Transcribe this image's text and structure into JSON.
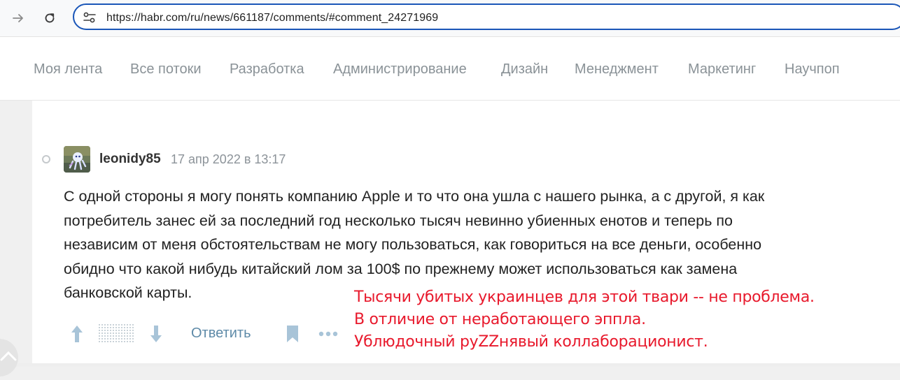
{
  "browser": {
    "url": "https://habr.com/ru/news/661187/comments/#comment_24271969"
  },
  "nav": {
    "items": [
      "Моя лента",
      "Все потоки",
      "Разработка",
      "Администрирование",
      "Дизайн",
      "Менеджмент",
      "Маркетинг",
      "Научпоп"
    ]
  },
  "comment": {
    "username": "leonidy85",
    "timestamp": "17 апр 2022 в 13:17",
    "body_lines": [
      "С одной стороны я могу понять компанию Apple и то что она ушла с нашего рынка, а с другой, я как",
      "потребитель занес ей за последний год несколько тысяч невинно убиенных енотов и теперь по",
      "независим от меня обстоятельствам не могу пользоваться, как говориться на все деньги, особенно",
      "обидно что какой нибудь китайский лом за 100$ по прежнему может использоваться как замена",
      "банковской карты."
    ],
    "reply_label": "Ответить"
  },
  "annotation": {
    "lines": [
      "Тысячи убитых украинцев для этой твари -- не проблема.",
      "В отличие от неработающего эппла.",
      "Ублюдочный руZZнявый коллаборационист."
    ],
    "color": "#e8192c"
  },
  "icons": {
    "back": "arrow-right-icon",
    "reload": "reload-icon",
    "site_info": "tune-icon",
    "upvote": "arrow-up-icon",
    "downvote": "arrow-down-icon",
    "bookmark": "bookmark-icon",
    "more": "more-icon"
  }
}
